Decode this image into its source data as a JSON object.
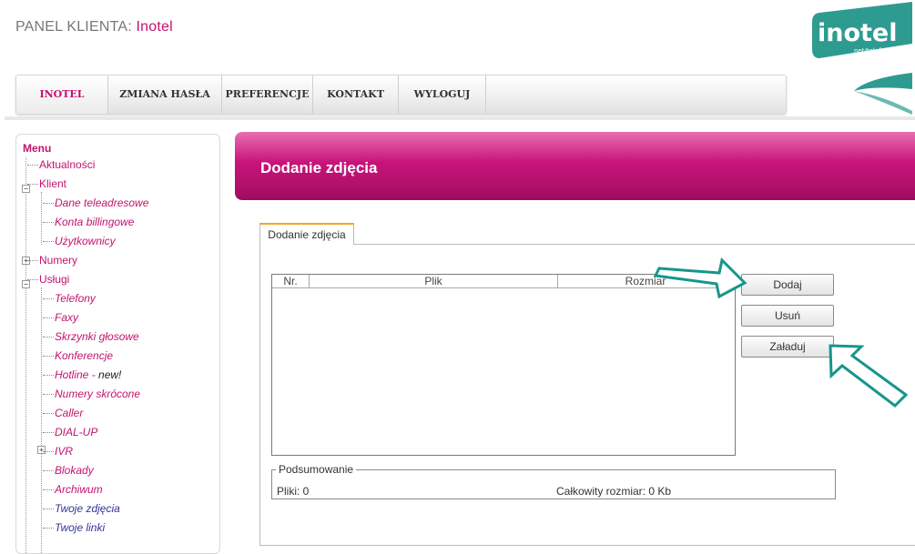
{
  "header": {
    "title_prefix": "PANEL KLIENTA: ",
    "title_name": "Inotel"
  },
  "logo": {
    "brand": "inotel",
    "tagline": "net/telefon/HDTV"
  },
  "nav": [
    {
      "label": "INOTEL",
      "active": true
    },
    {
      "label": "ZMIANA HASŁA"
    },
    {
      "label": "PREFERENCJE"
    },
    {
      "label": "KONTAKT"
    },
    {
      "label": "WYLOGUJ"
    }
  ],
  "sidebar": {
    "menu_title": "Menu",
    "items": [
      {
        "label": "Aktualności"
      },
      {
        "label": "Klient"
      },
      {
        "label": "Dane teleadresowe"
      },
      {
        "label": "Konta billingowe"
      },
      {
        "label": "Użytkownicy"
      },
      {
        "label": "Numery"
      },
      {
        "label": "Usługi"
      },
      {
        "label": "Telefony"
      },
      {
        "label": "Faxy"
      },
      {
        "label": "Skrzynki głosowe"
      },
      {
        "label": "Konferencje"
      },
      {
        "label": "Hotline - ",
        "badge": "new!"
      },
      {
        "label": "Numery skrócone"
      },
      {
        "label": "Caller"
      },
      {
        "label": "DIAL-UP"
      },
      {
        "label": "IVR"
      },
      {
        "label": "Blokady"
      },
      {
        "label": "Archiwum"
      },
      {
        "label": "Twoje zdjęcia"
      },
      {
        "label": "Twoje linki"
      }
    ]
  },
  "page": {
    "title": "Dodanie zdjęcia",
    "tab_label": "Dodanie zdjęcia"
  },
  "file_list": {
    "columns": [
      "Nr.",
      "Plik",
      "Rozmiar"
    ],
    "rows": []
  },
  "buttons": {
    "add": "Dodaj",
    "remove": "Usuń",
    "upload": "Załaduj"
  },
  "summary": {
    "legend": "Podsumowanie",
    "files_text": "Pliki: 0",
    "size_text": "Całkowity rozmiar: 0 Kb"
  },
  "colors": {
    "accent": "#c4126f",
    "logo_teal": "#2e9b91",
    "banner": "#c8137a",
    "arrow": "#16968b"
  }
}
